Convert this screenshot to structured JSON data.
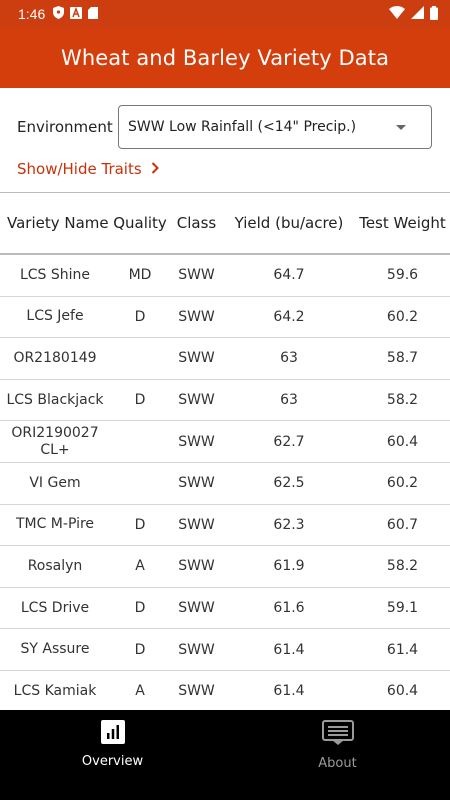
{
  "status_bar": {
    "time": "1:46",
    "icons": [
      "shield-icon",
      "a-icon",
      "sd-card-icon",
      "wifi-icon",
      "signal-icon",
      "battery-icon"
    ]
  },
  "app_bar": {
    "title": "Wheat and Barley Variety Data"
  },
  "environment": {
    "label": "Environment",
    "selected": "SWW Low Rainfall (<14\" Precip.)"
  },
  "traits_toggle": {
    "label": "Show/Hide Traits"
  },
  "table": {
    "headers": [
      "Variety Name",
      "Quality",
      "Class",
      "Yield (bu/acre)",
      "Test Weight"
    ],
    "rows": [
      [
        "LCS Shine",
        "MD",
        "SWW",
        "64.7",
        "59.6"
      ],
      [
        "LCS Jefe",
        "D",
        "SWW",
        "64.2",
        "60.2"
      ],
      [
        "OR2180149",
        "",
        "SWW",
        "63",
        "58.7"
      ],
      [
        "LCS Blackjack",
        "D",
        "SWW",
        "63",
        "58.2"
      ],
      [
        "ORI2190027 CL+",
        "",
        "SWW",
        "62.7",
        "60.4"
      ],
      [
        "VI Gem",
        "",
        "SWW",
        "62.5",
        "60.2"
      ],
      [
        "TMC M-Pire",
        "D",
        "SWW",
        "62.3",
        "60.7"
      ],
      [
        "Rosalyn",
        "A",
        "SWW",
        "61.9",
        "58.2"
      ],
      [
        "LCS Drive",
        "D",
        "SWW",
        "61.6",
        "59.1"
      ],
      [
        "SY Assure",
        "D",
        "SWW",
        "61.4",
        "61.4"
      ],
      [
        "LCS Kamiak",
        "A",
        "SWW",
        "61.4",
        "60.4"
      ]
    ]
  },
  "bottom_nav": {
    "items": [
      {
        "label": "Overview",
        "icon": "bar-chart-icon",
        "active": true
      },
      {
        "label": "About",
        "icon": "document-icon",
        "active": false
      }
    ]
  },
  "colors": {
    "brand": "#d43e0c",
    "status_bar": "#cc3d0f",
    "link": "#c8320a",
    "nav_background": "#000000"
  }
}
